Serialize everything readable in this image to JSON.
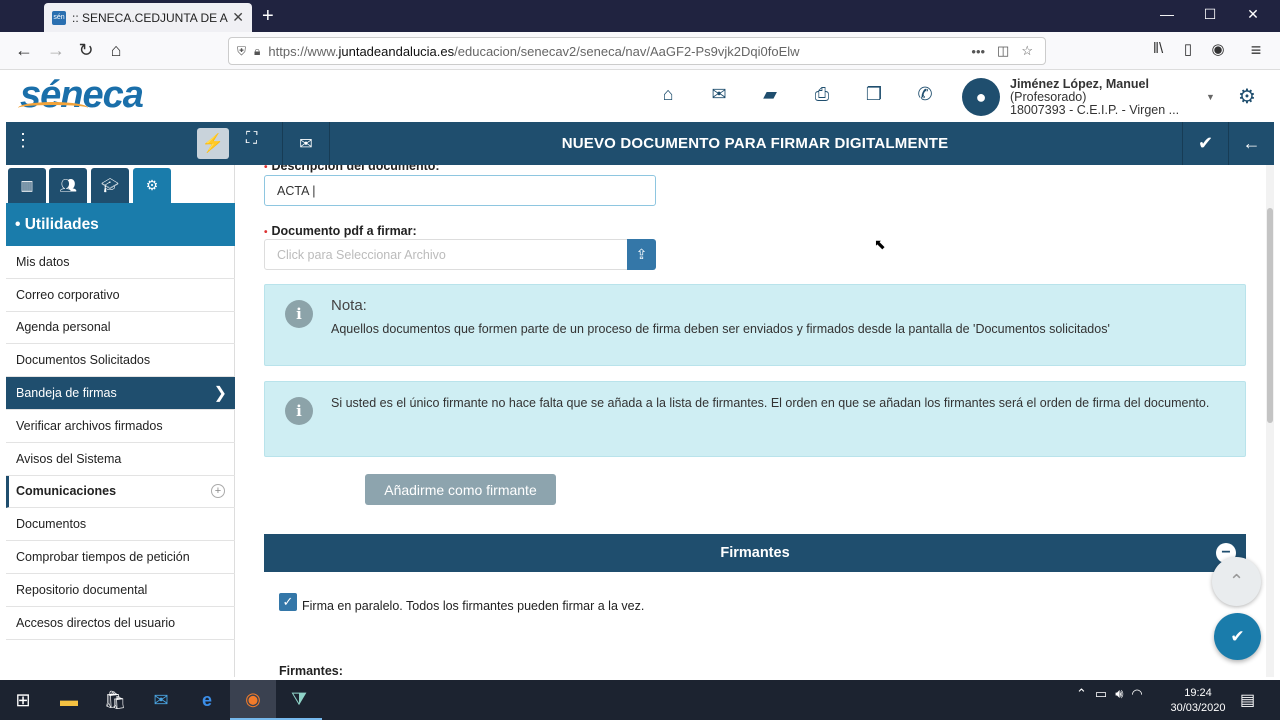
{
  "browser": {
    "tab_title": ":: SENECA.CEDJUNTA DE AND",
    "favicon_text": "sén",
    "url_prefix": "https://www.",
    "url_domain": "juntadeandalucia.es",
    "url_path": "/educacion/senecav2/seneca/nav/AaGF2-Ps9vjk2Dqi0foElw"
  },
  "app": {
    "logo": "séneca",
    "header_icons": [
      "home-icon",
      "envelope-icon",
      "folder-icon",
      "print-icon",
      "copy-icon",
      "phone-icon"
    ],
    "user_name": "Jiménez López, Manuel",
    "user_role": "(Profesorado)",
    "user_center": "18007393 - C.E.I.P. - Virgen ...",
    "page_title": "NUEVO DOCUMENTO PARA FIRMAR DIGITALMENTE"
  },
  "sidebar": {
    "section_title": "• Utilidades",
    "items": [
      {
        "label": "Mis datos"
      },
      {
        "label": "Correo corporativo"
      },
      {
        "label": "Agenda personal"
      },
      {
        "label": "Documentos Solicitados"
      },
      {
        "label": "Bandeja de firmas",
        "state": "active"
      },
      {
        "label": "Verificar archivos firmados"
      },
      {
        "label": "Avisos del Sistema"
      },
      {
        "label": "Comunicaciones",
        "state": "expandable"
      },
      {
        "label": "Documentos"
      },
      {
        "label": "Comprobar tiempos de petición"
      },
      {
        "label": "Repositorio documental"
      },
      {
        "label": "Accesos directos del usuario"
      }
    ]
  },
  "form": {
    "desc_label": "Descripción del documento:",
    "desc_value": "ACTA |",
    "pdf_label": "Documento pdf a firmar:",
    "pdf_placeholder": "Click para Seleccionar Archivo",
    "nota_title": "Nota:",
    "nota_text": "Aquellos documentos que formen parte de un proceso de firma deben ser enviados y firmados desde la pantalla de 'Documentos solicitados'",
    "info2_text": "Si usted es el único firmante no hace falta que se añada a la lista de firmantes. El orden en que se añadan los firmantes será el orden de firma del documento.",
    "add_button": "Añadirme como firmante",
    "firmantes_header": "Firmantes",
    "parallel_label": "Firma en paralelo. Todos los firmantes pueden firmar a la vez.",
    "parallel_checked": true,
    "firmantes_label": "Firmantes:"
  },
  "taskbar": {
    "time": "19:24",
    "date": "30/03/2020"
  },
  "colors": {
    "primary": "#1f4e6e",
    "accent": "#1a7cab",
    "info_bg": "#cfeef3"
  }
}
